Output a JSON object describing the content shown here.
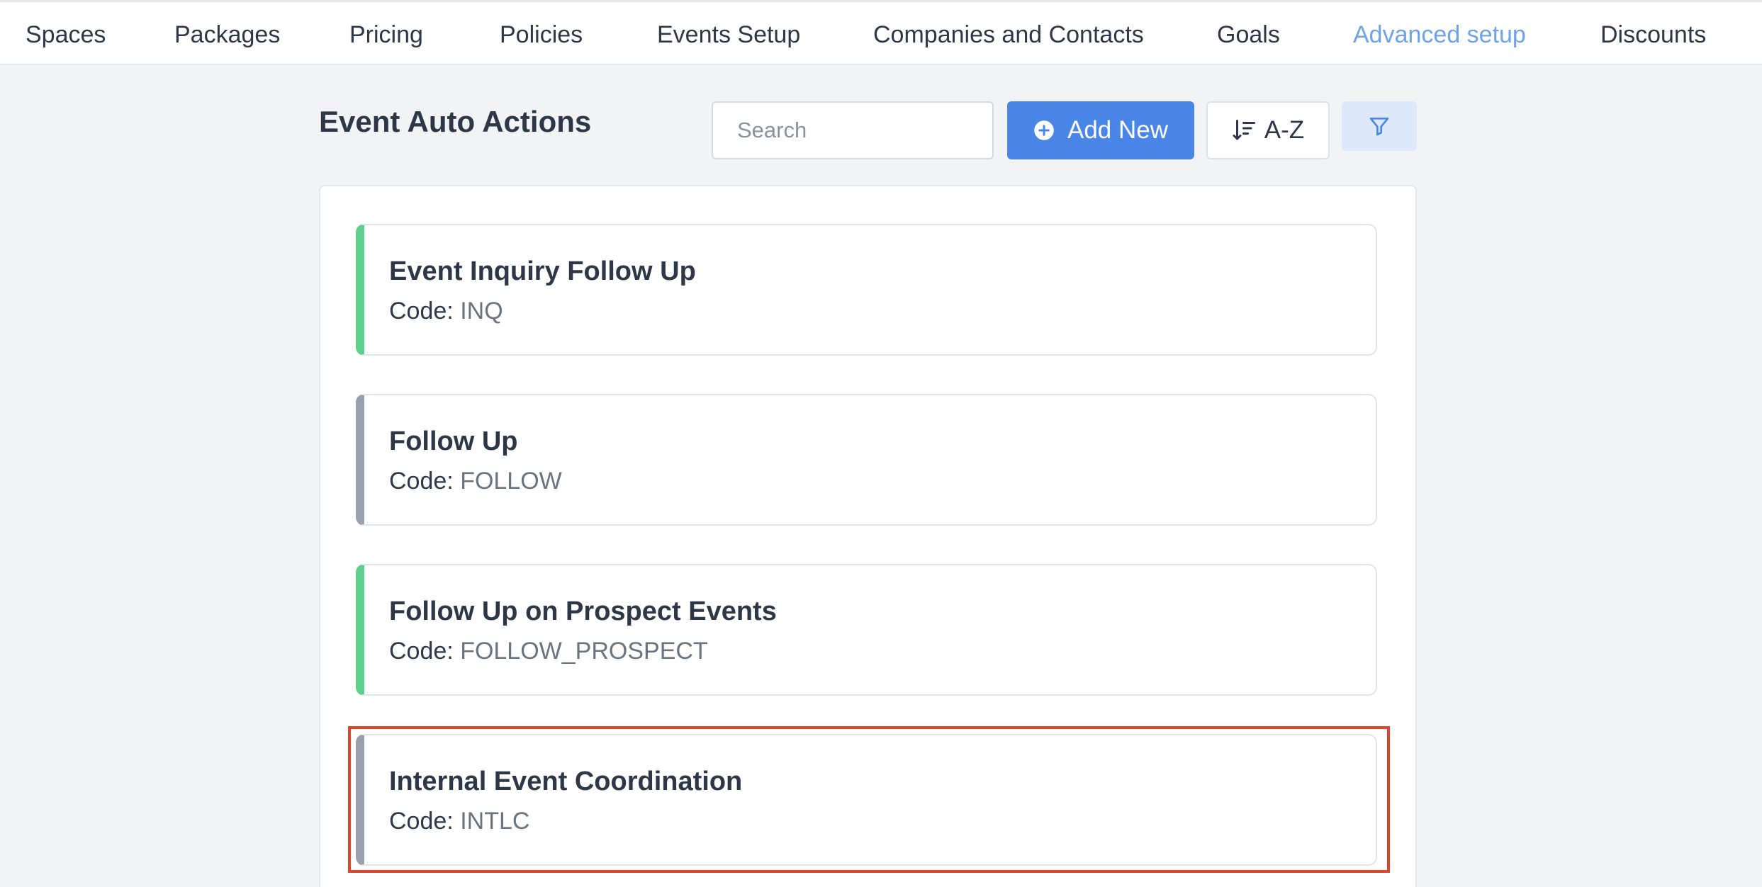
{
  "nav": {
    "items": [
      {
        "label": "Spaces"
      },
      {
        "label": "Packages"
      },
      {
        "label": "Pricing"
      },
      {
        "label": "Policies"
      },
      {
        "label": "Events Setup"
      },
      {
        "label": "Companies and Contacts"
      },
      {
        "label": "Goals"
      },
      {
        "label": "Advanced setup",
        "active": true
      },
      {
        "label": "Discounts"
      }
    ]
  },
  "header": {
    "title": "Event Auto Actions",
    "search_placeholder": "Search",
    "search_value": "",
    "add_label": "Add New",
    "sort_label": "A-Z"
  },
  "actions": [
    {
      "title": "Event Inquiry Follow Up",
      "code_label": "Code:",
      "code": "INQ",
      "accent": "#5fcf8f"
    },
    {
      "title": "Follow Up",
      "code_label": "Code:",
      "code": "FOLLOW",
      "accent": "#9aa0ab"
    },
    {
      "title": "Follow Up on Prospect Events",
      "code_label": "Code:",
      "code": "FOLLOW_PROSPECT",
      "accent": "#5fcf8f"
    },
    {
      "title": "Internal Event Coordination",
      "code_label": "Code:",
      "code": "INTLC",
      "accent": "#9aa0ab",
      "highlighted": true
    }
  ],
  "colors": {
    "accent": "#4a86e8",
    "active_nav": "#6ea3e8",
    "highlight": "#e0442a"
  },
  "icons": {
    "add": "plus-circle-icon",
    "sort": "sort-descending-icon",
    "filter": "filter-icon"
  }
}
